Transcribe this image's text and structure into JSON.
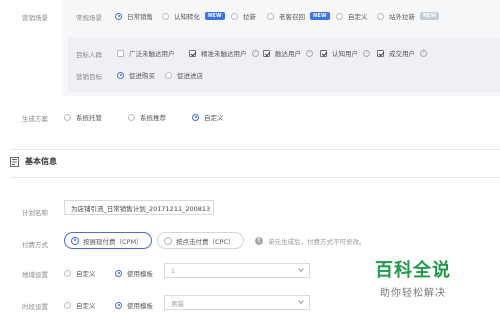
{
  "marketing_scene": {
    "section_label": "营销场景",
    "row_label": "常规场景",
    "options": [
      {
        "label": "日常销售",
        "selected": true
      },
      {
        "label": "认知转化",
        "badge": "NEW"
      },
      {
        "label": "拉新"
      },
      {
        "label": "老客召回",
        "badge": "NEW"
      },
      {
        "label": "自定义"
      },
      {
        "label": "站外拉新",
        "badge": "NEW"
      }
    ],
    "target_group_label": "目标人群",
    "target_groups": [
      {
        "label": "广泛未触达用户",
        "checked": false
      },
      {
        "label": "精准未触达用户",
        "checked": true
      },
      {
        "label": "触达用户",
        "checked": true
      },
      {
        "label": "认知用户",
        "checked": true
      },
      {
        "label": "成交用户",
        "checked": true
      }
    ],
    "goal_label": "营销目标",
    "goals": [
      {
        "label": "促进购买",
        "selected": true
      },
      {
        "label": "促进进店",
        "selected": false
      }
    ]
  },
  "plan_generation": {
    "label": "生成方案",
    "options": [
      {
        "label": "系统托管",
        "selected": false
      },
      {
        "label": "系统推荐",
        "selected": false
      },
      {
        "label": "自定义",
        "selected": true
      }
    ]
  },
  "basic_info": {
    "title": "基本信息",
    "plan_name_label": "计划名称",
    "plan_name_value": "为店铺引流_日常销售计划_20171211_200813",
    "billing_label": "付费方式",
    "billing_options": [
      {
        "label": "按展现付费（CPM）",
        "selected": true
      },
      {
        "label": "按点击付费（CPC）",
        "selected": false
      }
    ],
    "billing_hint": "单元生成后，付费方式不可修改。",
    "region_label": "地域设置",
    "region_options": [
      {
        "label": "自定义",
        "selected": false
      },
      {
        "label": "使用模板",
        "selected": true
      }
    ],
    "region_select_value": "1",
    "time_label": "时段设置",
    "time_options": [
      {
        "label": "自定义",
        "selected": false
      },
      {
        "label": "使用模板",
        "selected": true
      }
    ],
    "time_select_value": "男装"
  },
  "watermark": {
    "title": "百科全说",
    "subtitle": "助你轻松解决"
  },
  "colors": {
    "accent": "#4a6fd0",
    "badge": "#3d74e8",
    "watermark": "#1f9a4a"
  }
}
